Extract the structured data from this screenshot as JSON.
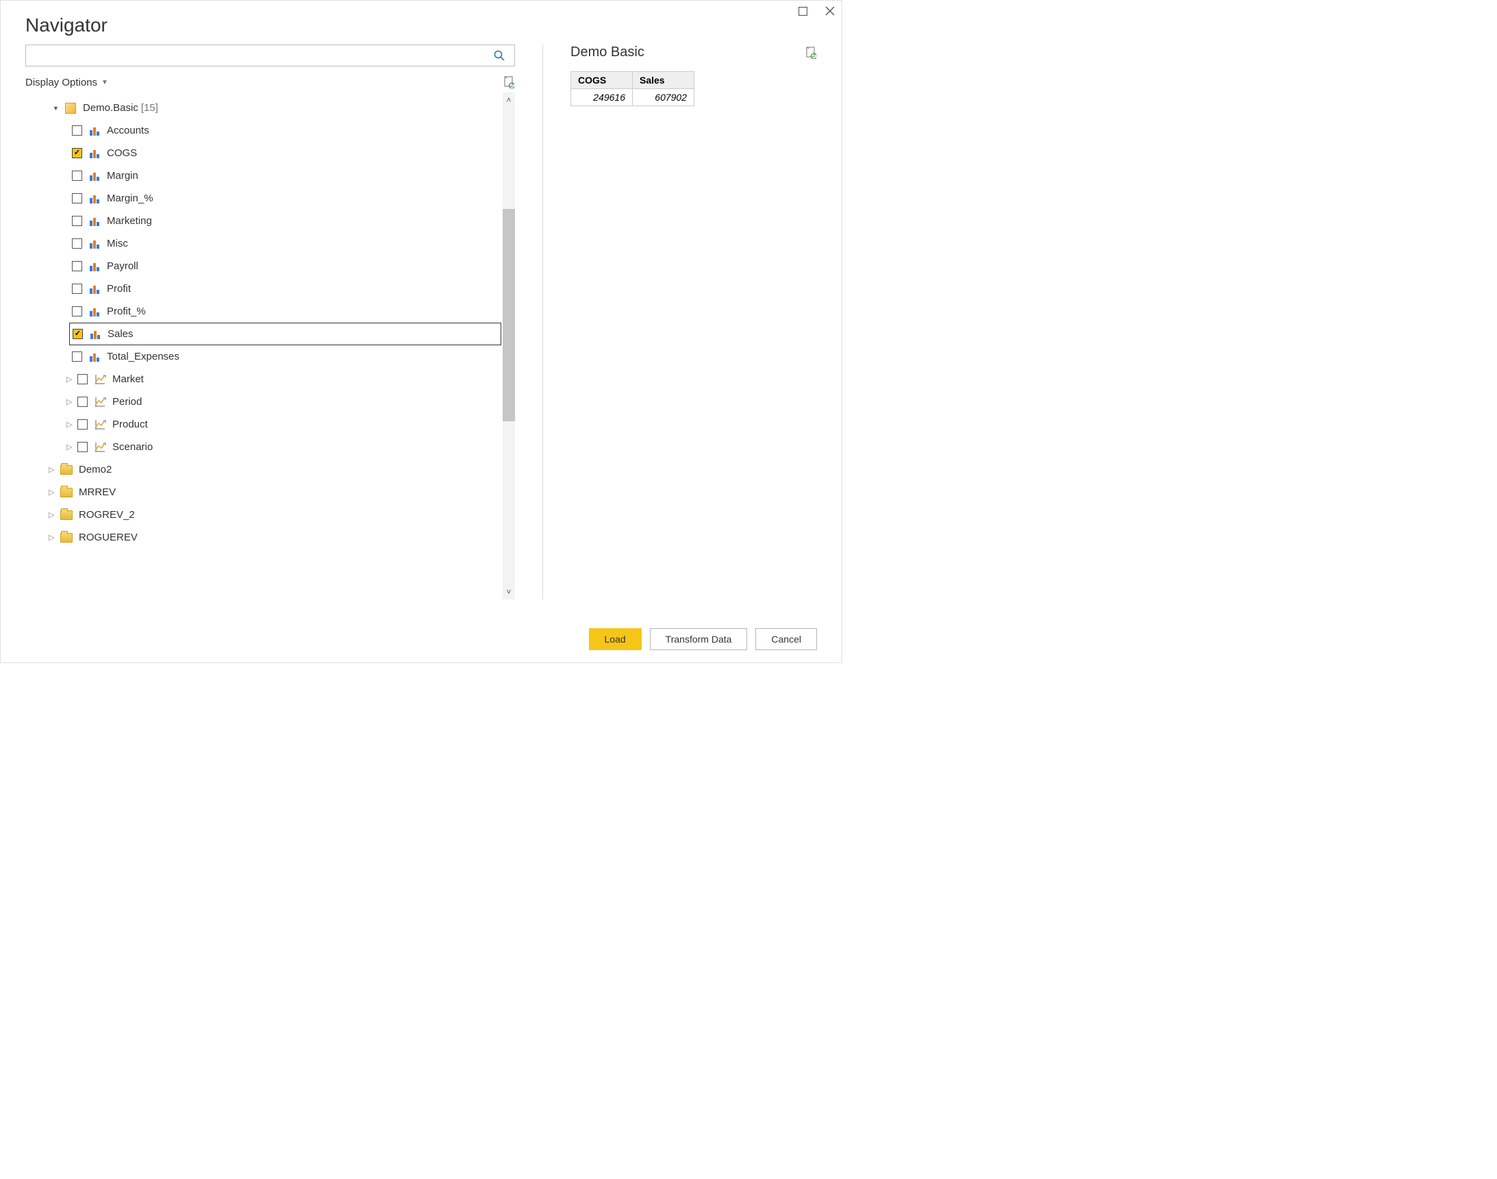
{
  "title": "Navigator",
  "search": {
    "placeholder": ""
  },
  "displayOptions": "Display Options",
  "root": {
    "label": "Demo.Basic",
    "count": "[15]"
  },
  "items": [
    {
      "label": "Accounts",
      "checked": false
    },
    {
      "label": "COGS",
      "checked": true
    },
    {
      "label": "Margin",
      "checked": false
    },
    {
      "label": "Margin_%",
      "checked": false
    },
    {
      "label": "Marketing",
      "checked": false
    },
    {
      "label": "Misc",
      "checked": false
    },
    {
      "label": "Payroll",
      "checked": false
    },
    {
      "label": "Profit",
      "checked": false
    },
    {
      "label": "Profit_%",
      "checked": false
    },
    {
      "label": "Sales",
      "checked": true,
      "selected": true
    },
    {
      "label": "Total_Expenses",
      "checked": false
    }
  ],
  "dims": [
    {
      "label": "Market"
    },
    {
      "label": "Period"
    },
    {
      "label": "Product"
    },
    {
      "label": "Scenario"
    }
  ],
  "folders": [
    {
      "label": "Demo2"
    },
    {
      "label": "MRREV"
    },
    {
      "label": "ROGREV_2"
    },
    {
      "label": "ROGUEREV"
    }
  ],
  "preview": {
    "title": "Demo Basic",
    "headers": [
      "COGS",
      "Sales"
    ],
    "row": [
      "249616",
      "607902"
    ]
  },
  "buttons": {
    "load": "Load",
    "transform": "Transform Data",
    "cancel": "Cancel"
  }
}
